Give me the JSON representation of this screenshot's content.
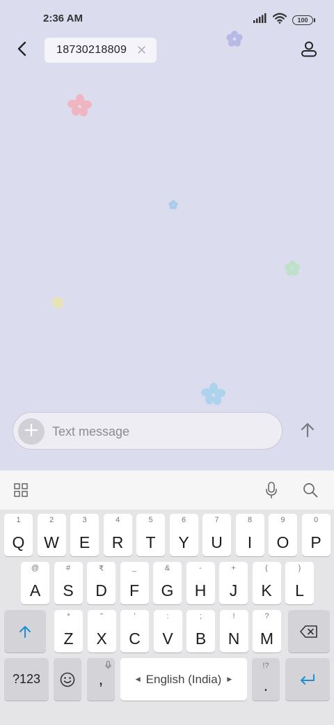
{
  "status_bar": {
    "time": "2:36 AM",
    "battery_level": "100",
    "icons": [
      "signal-icon",
      "wifi-icon",
      "battery-icon"
    ]
  },
  "header": {
    "back_icon": "chevron-left-icon",
    "recipient": "18730218809",
    "remove_icon": "close-icon",
    "contact_icon": "person-icon"
  },
  "compose": {
    "placeholder": "Text message",
    "value": "",
    "attach_icon": "plus-icon",
    "send_icon": "arrow-up-icon"
  },
  "keyboard": {
    "toolbar_icons": [
      "grid-icon",
      "microphone-icon",
      "search-icon"
    ],
    "rows": [
      [
        {
          "main": "Q",
          "sub": "1"
        },
        {
          "main": "W",
          "sub": "2"
        },
        {
          "main": "E",
          "sub": "3"
        },
        {
          "main": "R",
          "sub": "4"
        },
        {
          "main": "T",
          "sub": "5"
        },
        {
          "main": "Y",
          "sub": "6"
        },
        {
          "main": "U",
          "sub": "7"
        },
        {
          "main": "I",
          "sub": "8"
        },
        {
          "main": "O",
          "sub": "9"
        },
        {
          "main": "P",
          "sub": "0"
        }
      ],
      [
        {
          "main": "A",
          "sub": "@"
        },
        {
          "main": "S",
          "sub": "#"
        },
        {
          "main": "D",
          "sub": "₹"
        },
        {
          "main": "F",
          "sub": "_"
        },
        {
          "main": "G",
          "sub": "&"
        },
        {
          "main": "H",
          "sub": "-"
        },
        {
          "main": "J",
          "sub": "+"
        },
        {
          "main": "K",
          "sub": "("
        },
        {
          "main": "L",
          "sub": ")"
        }
      ],
      [
        {
          "main": "Z",
          "sub": "*"
        },
        {
          "main": "X",
          "sub": "\""
        },
        {
          "main": "C",
          "sub": "'"
        },
        {
          "main": "V",
          "sub": ":"
        },
        {
          "main": "B",
          "sub": ";"
        },
        {
          "main": "N",
          "sub": "!"
        },
        {
          "main": "M",
          "sub": "?"
        }
      ]
    ],
    "shift_icon": "shift-arrow-icon",
    "backspace_icon": "backspace-icon",
    "symbols_label": "?123",
    "emoji_icon": "emoji-icon",
    "comma_label": ",",
    "space_label": "English (India)",
    "period_label": ".",
    "period_sub": "!?",
    "enter_icon": "enter-icon"
  },
  "colors": {
    "background": "#dcdcef",
    "accent": "#1a8fd6"
  }
}
